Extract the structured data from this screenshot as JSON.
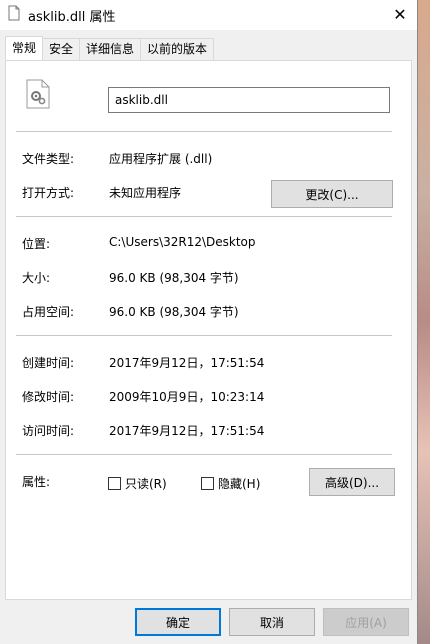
{
  "window": {
    "title": "asklib.dll 属性",
    "close_glyph": "✕"
  },
  "tabs": [
    {
      "label": "常规"
    },
    {
      "label": "安全"
    },
    {
      "label": "详细信息"
    },
    {
      "label": "以前的版本"
    }
  ],
  "general": {
    "file_name": "asklib.dll",
    "file_type_label": "文件类型:",
    "file_type_value": "应用程序扩展 (.dll)",
    "opens_with_label": "打开方式:",
    "opens_with_value": "未知应用程序",
    "change_button": "更改(C)...",
    "location_label": "位置:",
    "location_value": "C:\\Users\\32R12\\Desktop",
    "size_label": "大小:",
    "size_value": "96.0 KB (98,304 字节)",
    "size_on_disk_label": "占用空间:",
    "size_on_disk_value": "96.0 KB (98,304 字节)",
    "created_label": "创建时间:",
    "created_value": "2017年9月12日，17:51:54",
    "modified_label": "修改时间:",
    "modified_value": "2009年10月9日，10:23:14",
    "accessed_label": "访问时间:",
    "accessed_value": "2017年9月12日，17:51:54",
    "attributes_label": "属性:",
    "readonly_label": "只读(R)",
    "hidden_label": "隐藏(H)",
    "advanced_button": "高级(D)..."
  },
  "footer": {
    "ok": "确定",
    "cancel": "取消",
    "apply": "应用(A)"
  },
  "icons": {
    "title": "document-icon",
    "file": "dll-gear-file-icon"
  }
}
